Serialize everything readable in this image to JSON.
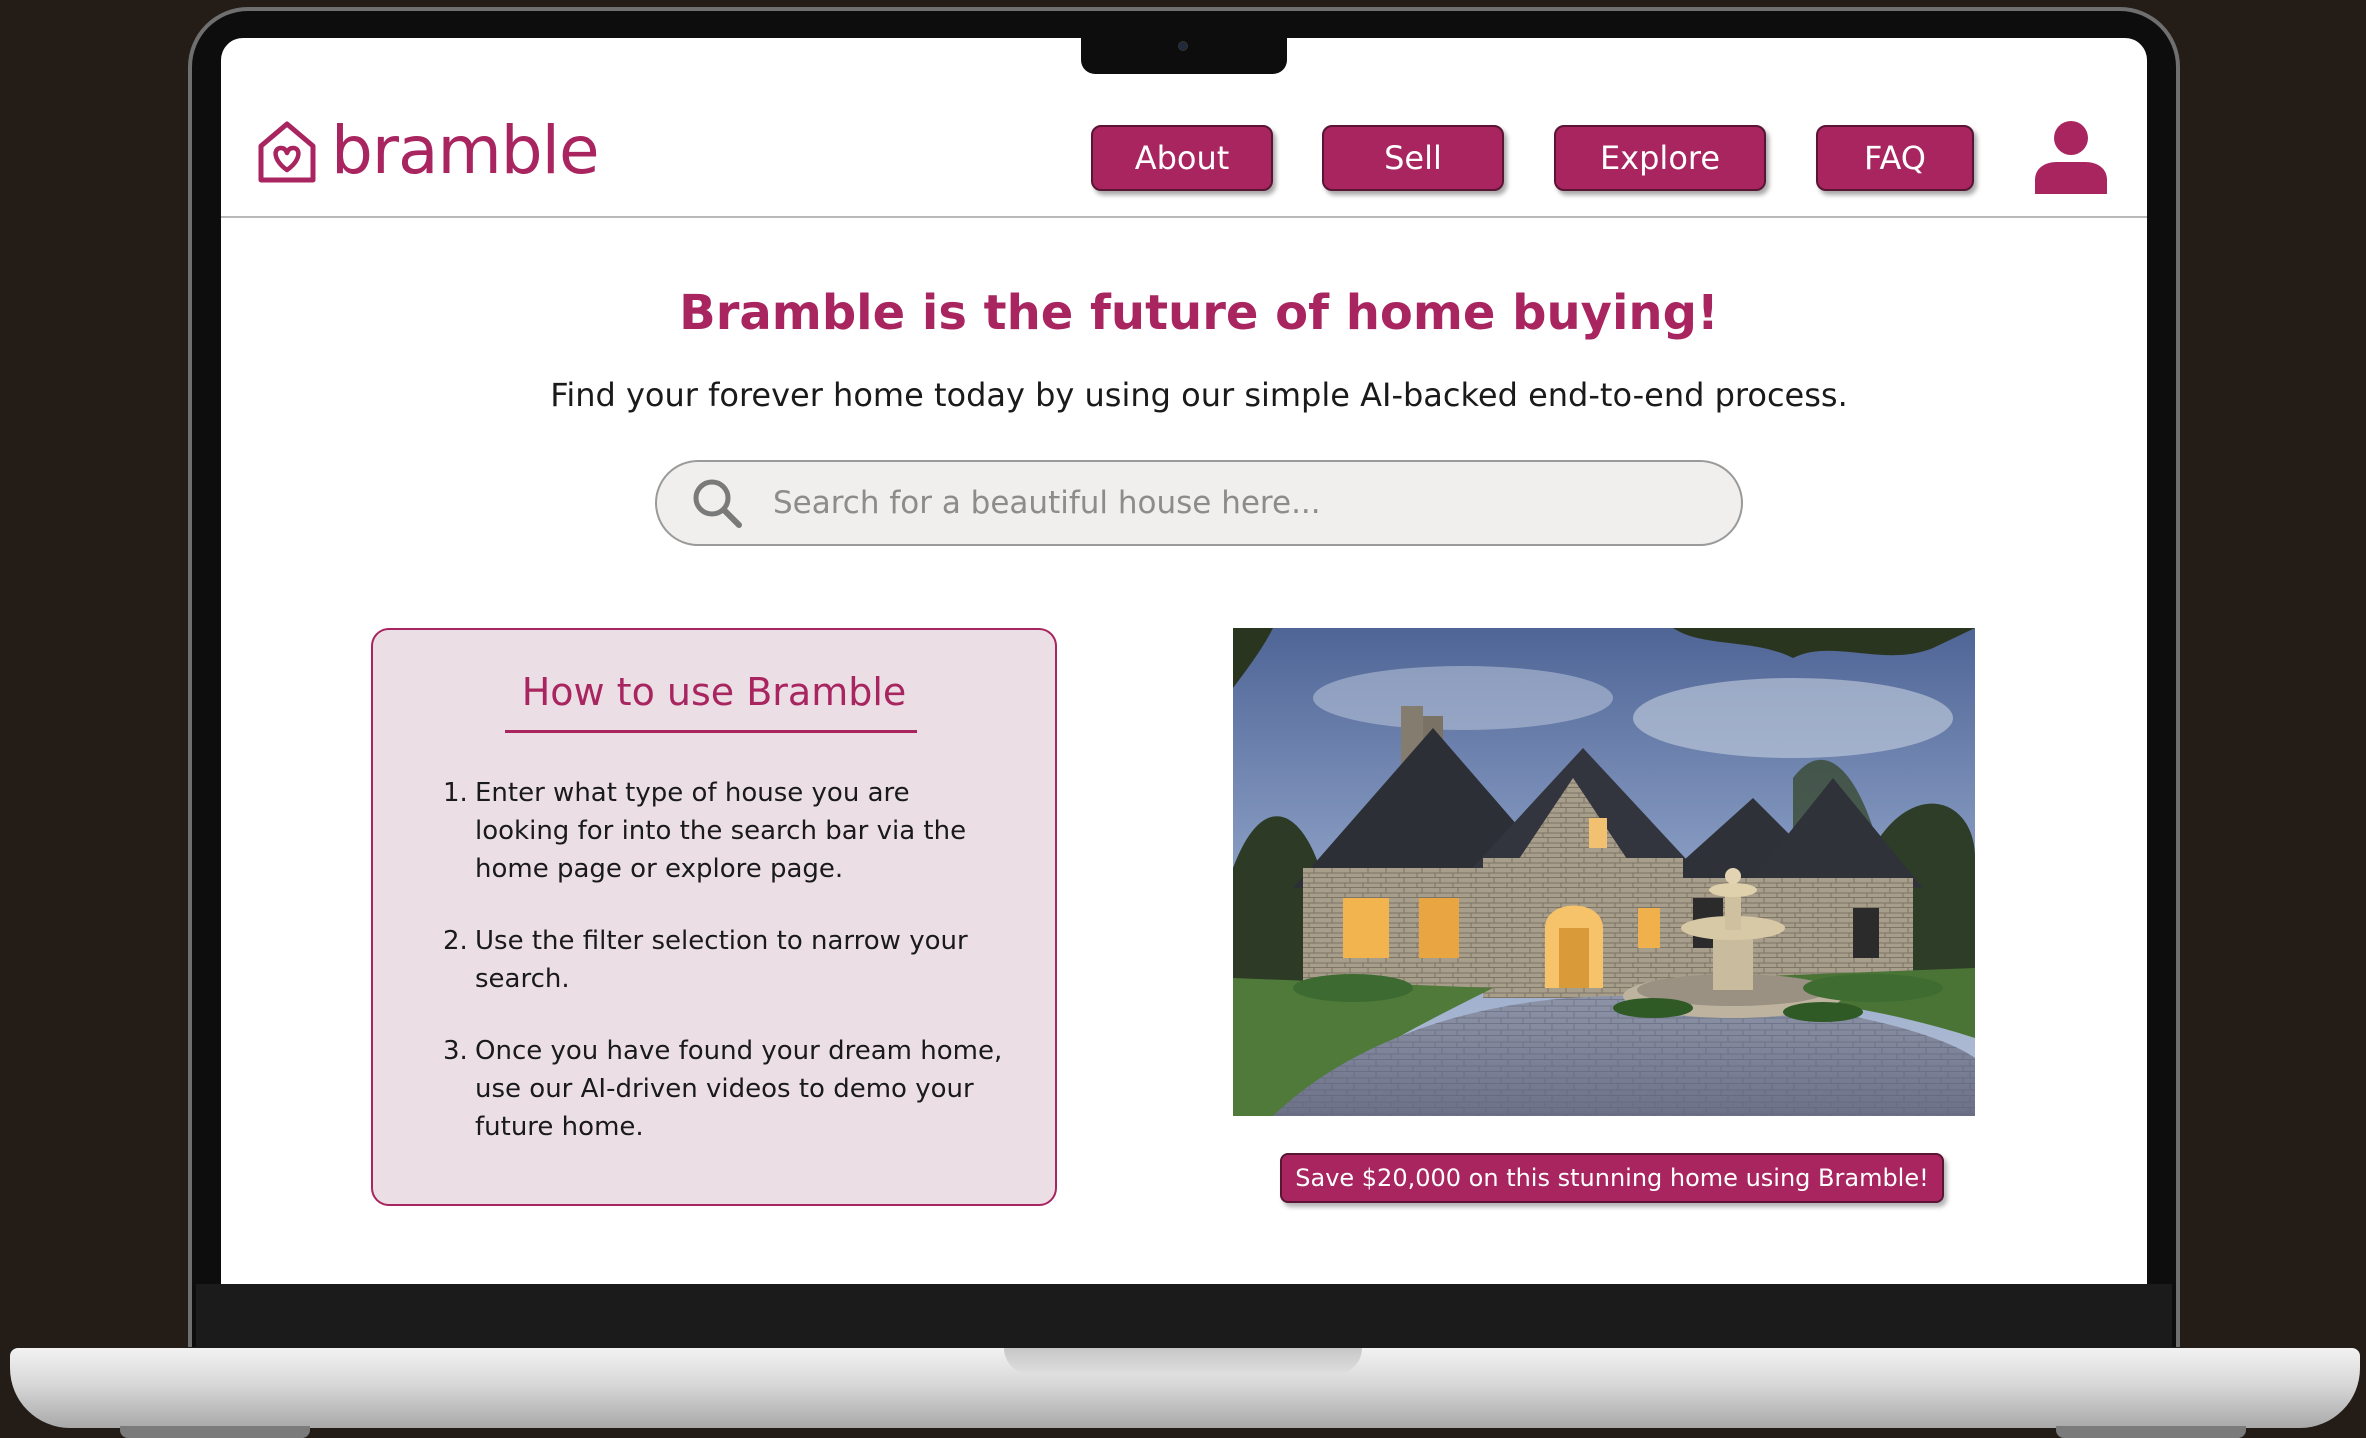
{
  "brand": {
    "name": "bramble",
    "accent_color": "#a82560",
    "logo_icon": "house-heart-icon"
  },
  "nav": {
    "items": [
      {
        "label": "About"
      },
      {
        "label": "Sell"
      },
      {
        "label": "Explore"
      },
      {
        "label": "FAQ"
      }
    ],
    "user_icon": "user-icon"
  },
  "hero": {
    "headline": "Bramble is the future of home buying!",
    "subline": "Find your forever home today by using our simple AI-backed end-to-end process."
  },
  "search": {
    "placeholder": "Search for a beautiful house here...",
    "value": "",
    "icon": "search-icon"
  },
  "howto": {
    "title": "How to use Bramble",
    "steps": [
      {
        "num": "1.",
        "text": "Enter what type of house you are looking for into the search bar via the home page or explore page."
      },
      {
        "num": "2.",
        "text": "Use the filter selection to narrow your search."
      },
      {
        "num": "3.",
        "text": "Once you have found your dream home, use our AI-driven videos to demo your future home."
      }
    ]
  },
  "feature": {
    "promo_label": "Save $20,000 on this stunning home using Bramble!"
  }
}
